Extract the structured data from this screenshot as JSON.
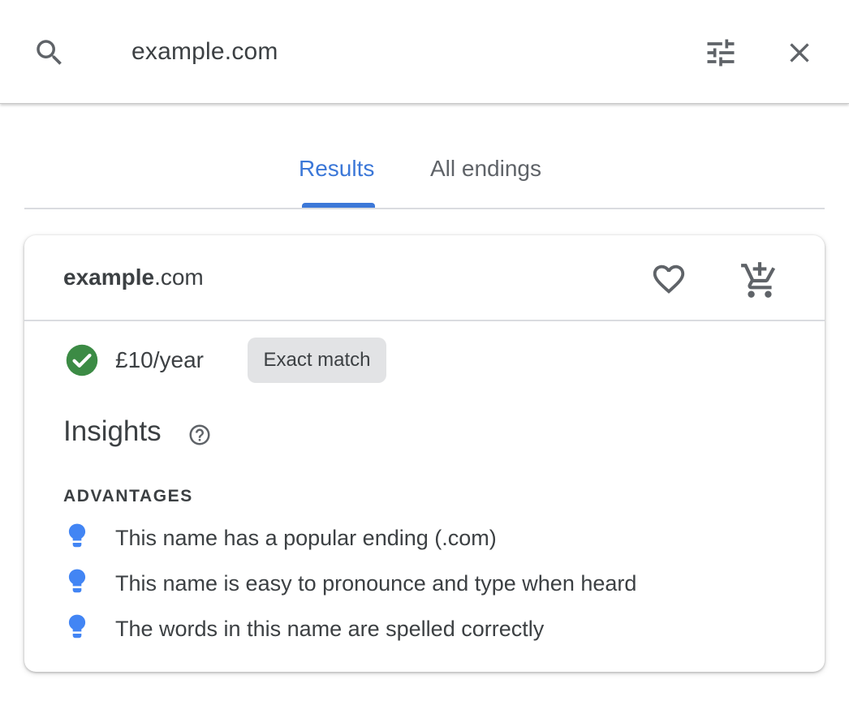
{
  "search": {
    "query": "example.com",
    "icon": "search-icon",
    "filter_icon": "tune-icon",
    "close_icon": "close-icon"
  },
  "tabs": [
    {
      "label": "Results",
      "active": true
    },
    {
      "label": "All endings",
      "active": false
    }
  ],
  "result": {
    "domain_sld": "example",
    "domain_tld": ".com",
    "favorite_icon": "heart-outline-icon",
    "cart_icon": "add-shopping-cart-icon",
    "availability_icon": "check-circle-icon",
    "price": "£10/year",
    "badge": "Exact match",
    "insights": {
      "title": "Insights",
      "help_icon": "help-outline-icon",
      "advantages_heading": "ADVANTAGES",
      "advantages": [
        "This name has a popular ending (.com)",
        "This name is easy to pronounce and type when heard",
        "The words in this name are spelled correctly"
      ],
      "advantage_icon": "lightbulb-icon"
    }
  },
  "colors": {
    "accent": "#3c78d8",
    "success": "#3c8b45",
    "bulb": "#4285f4",
    "text": "#3c4043",
    "badge_bg": "#e2e3e5"
  }
}
